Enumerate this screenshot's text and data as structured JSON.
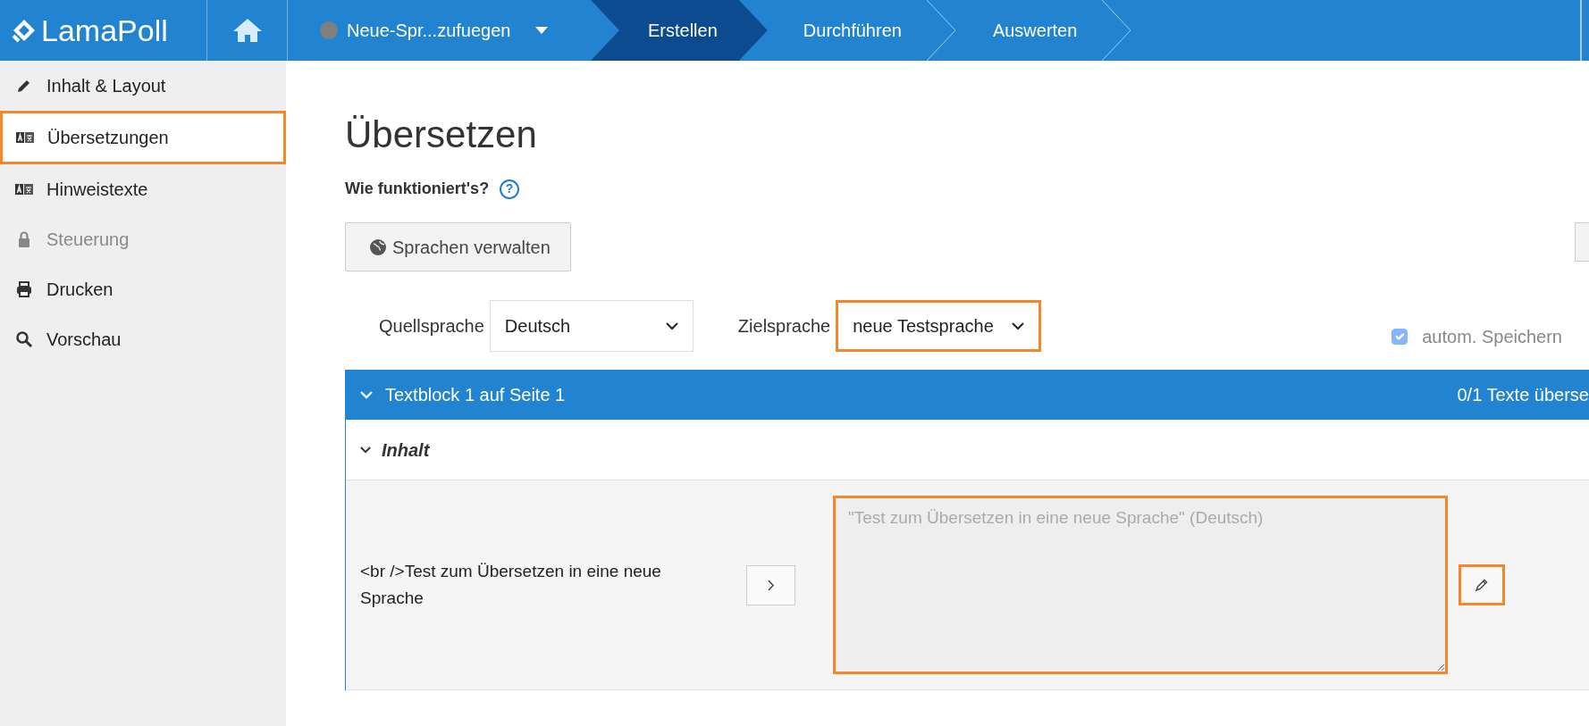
{
  "topbar": {
    "logo": "LamaPoll",
    "survey": {
      "label": "Neue-Spr...zufuegen"
    },
    "steps": [
      {
        "label": "Erstellen",
        "selected": true
      },
      {
        "label": "Durchführen",
        "selected": false
      },
      {
        "label": "Auswerten",
        "selected": false
      }
    ]
  },
  "sidebar": {
    "items": [
      {
        "label": "Inhalt & Layout",
        "selected": false,
        "disabled": false,
        "highlighted": false
      },
      {
        "label": "Übersetzungen",
        "selected": true,
        "disabled": false,
        "highlighted": true
      },
      {
        "label": "Hinweistexte",
        "selected": false,
        "disabled": false,
        "highlighted": false
      },
      {
        "label": "Steuerung",
        "selected": false,
        "disabled": true,
        "highlighted": false
      },
      {
        "label": "Drucken",
        "selected": false,
        "disabled": false,
        "highlighted": false
      },
      {
        "label": "Vorschau",
        "selected": false,
        "disabled": false,
        "highlighted": false
      }
    ]
  },
  "page": {
    "title": "Übersetzen",
    "help": {
      "label": "Wie funktioniert's?",
      "icon_text": "?"
    },
    "manage_button": "Sprachen verwalten",
    "source_language": {
      "label": "Quellsprache",
      "value": "Deutsch",
      "highlighted": false
    },
    "target_language": {
      "label": "Zielsprache",
      "value": "neue Testsprache",
      "highlighted": true
    },
    "autosave": {
      "label": "autom. Speichern",
      "checked": true,
      "disabled": true
    },
    "block": {
      "title": "Textblock 1 auf Seite 1",
      "progress": "0/1 Texte überse",
      "expanded": true,
      "section": {
        "title": "Inhalt",
        "expanded": true
      },
      "entries": [
        {
          "source": "<br />Test zum Übersetzen in eine neue Sprache",
          "placeholder": "\"Test zum Übersetzen in eine neue Sprache\" (Deutsch)",
          "field_highlighted": true,
          "edit_highlighted": true
        }
      ]
    }
  }
}
